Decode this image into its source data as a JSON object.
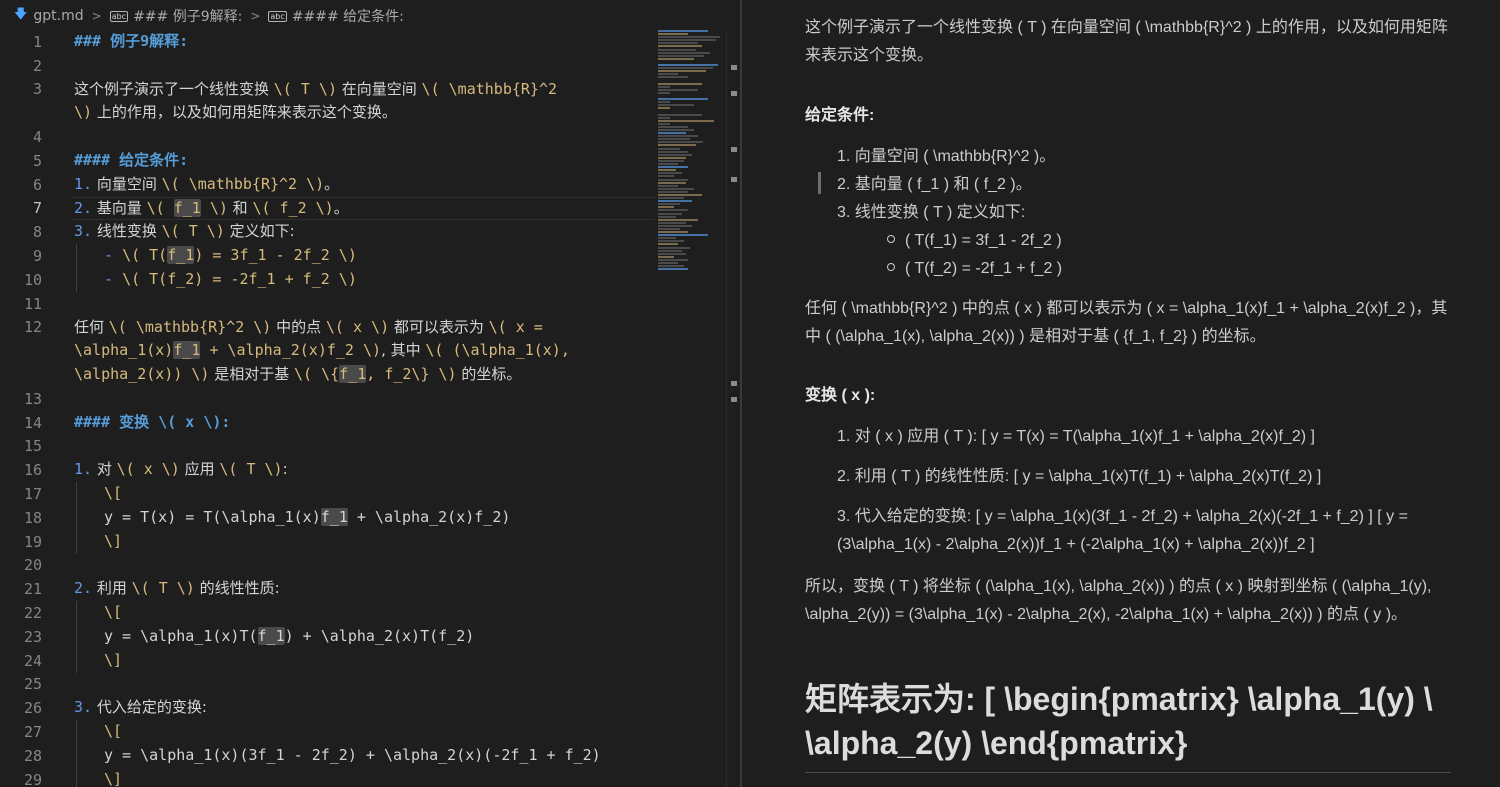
{
  "breadcrumb": {
    "file": "gpt.md",
    "section1": "### 例子9解释:",
    "section2": "#### 给定条件:"
  },
  "editor": {
    "line_numbers": [
      "1",
      "2",
      "3",
      "4",
      "5",
      "6",
      "7",
      "8",
      "9",
      "10",
      "11",
      "12",
      "13",
      "14",
      "15",
      "16",
      "17",
      "18",
      "19",
      "20",
      "21",
      "22",
      "23",
      "24",
      "25",
      "26",
      "27",
      "28",
      "29"
    ],
    "l1": "### 例子9解释:",
    "l3a": "这个例子演示了一个线性变换 ",
    "l3b": "\\( T \\)",
    "l3c": " 在向量空间 ",
    "l3d": "\\( \\mathbb{R}^2",
    "l3e": "\\)",
    "l3f": " 上的作用，以及如何用矩阵来表示这个变换。",
    "l5": "#### 给定条件:",
    "l6a": "1.",
    "l6b": " 向量空间 ",
    "l6c": "\\( \\mathbb{R}^2 \\)",
    "l6d": "。",
    "l7a": "2.",
    "l7b": " 基向量 ",
    "l7c": "\\( ",
    "l7d": "f_1",
    "l7e": " \\)",
    "l7f": " 和 ",
    "l7g": "\\( f_2 \\)",
    "l7h": "。",
    "l8a": "3.",
    "l8b": " 线性变换 ",
    "l8c": "\\( T \\)",
    "l8d": " 定义如下:",
    "l9a": "- ",
    "l9b": "\\( T(",
    "l9c": "f_1",
    "l9d": ") = 3f_1 - 2f_2 \\)",
    "l10a": "- ",
    "l10b": "\\( T(f_2) = -2f_1 + f_2 \\)",
    "l12a": "任何 ",
    "l12b": "\\( \\mathbb{R}^2 \\)",
    "l12c": " 中的点 ",
    "l12d": "\\( x \\)",
    "l12e": " 都可以表示为 ",
    "l12f": "\\( x =",
    "l12g": "\\alpha_1(x)",
    "l12h": "f_1",
    "l12i": " + \\alpha_2(x)f_2 \\)",
    "l12j": ", 其中 ",
    "l12k": "\\( (\\alpha_1(x),",
    "l12l": "\\alpha_2(x)) \\)",
    "l12m": " 是相对于基 ",
    "l12n": "\\( \\{",
    "l12o": "f_1",
    "l12p": ", f_2\\} \\)",
    "l12q": " 的坐标。",
    "l14a": "#### 变换 ",
    "l14b": "\\( x \\)",
    "l14c": ":",
    "l16a": "1.",
    "l16b": " 对 ",
    "l16c": "\\( x \\)",
    "l16d": " 应用 ",
    "l16e": "\\( T \\)",
    "l16f": ":",
    "l17": "\\[",
    "l18a": "y = T(x) = T(\\alpha_1(x)",
    "l18b": "f_1",
    "l18c": " + \\alpha_2(x)f_2)",
    "l19": "\\]",
    "l21a": "2.",
    "l21b": " 利用 ",
    "l21c": "\\( T \\)",
    "l21d": " 的线性性质:",
    "l22": "\\[",
    "l23a": "y = \\alpha_1(x)T(",
    "l23b": "f_1",
    "l23c": ") + \\alpha_2(x)T(f_2)",
    "l24": "\\]",
    "l26a": "3.",
    "l26b": " 代入给定的变换:",
    "l27": "\\[",
    "l28": "y = \\alpha_1(x)(3f_1 - 2f_2) + \\alpha_2(x)(-2f_1 + f_2)",
    "l29": "\\]"
  },
  "preview": {
    "p1": "这个例子演示了一个线性变换 ( T ) 在向量空间 ( \\mathbb{R}^2 ) 上的作用，以及如何用矩阵来表示这个变换。",
    "h_given": "给定条件:",
    "li1": "1. 向量空间 ( \\mathbb{R}^2 )。",
    "li2": "2. 基向量 ( f_1 ) 和 ( f_2 )。",
    "li3": "3. 线性变换 ( T ) 定义如下:",
    "sub1": "( T(f_1) = 3f_1 - 2f_2 )",
    "sub2": "( T(f_2) = -2f_1 + f_2 )",
    "p2": "任何 ( \\mathbb{R}^2 ) 中的点 ( x ) 都可以表示为 ( x = \\alpha_1(x)f_1 + \\alpha_2(x)f_2 )，其中 ( (\\alpha_1(x), \\alpha_2(x)) ) 是相对于基 ( {f_1, f_2} ) 的坐标。",
    "h_transform": "变换 ( x ):",
    "t1": "1. 对 ( x ) 应用 ( T ):  [ y = T(x) = T(\\alpha_1(x)f_1 + \\alpha_2(x)f_2) ]",
    "t2": "2. 利用 ( T ) 的线性性质:  [ y = \\alpha_1(x)T(f_1) + \\alpha_2(x)T(f_2) ]",
    "t3": "3. 代入给定的变换:  [ y = \\alpha_1(x)(3f_1 - 2f_2) + \\alpha_2(x)(-2f_1 + f_2) ] [ y = (3\\alpha_1(x) - 2\\alpha_2(x))f_1 + (-2\\alpha_1(x) + \\alpha_2(x))f_2 ]",
    "p3": "所以，变换 ( T ) 将坐标 ( (\\alpha_1(x), \\alpha_2(x)) ) 的点 ( x ) 映射到坐标 ( (\\alpha_1(y), \\alpha_2(y)) = (3\\alpha_1(x) - 2\\alpha_2(x), -2\\alpha_1(x) + \\alpha_2(x)) ) 的点 ( y )。",
    "h_matrix": "矩阵表示为:  [ \\begin{pmatrix} \\alpha_1(y) \\ \\alpha_2(y) \\end{pmatrix}"
  },
  "colors": {
    "background": "#1e1e1e",
    "heading": "#569cd6",
    "math": "#d7ba7d",
    "list_number": "#6796e6"
  }
}
